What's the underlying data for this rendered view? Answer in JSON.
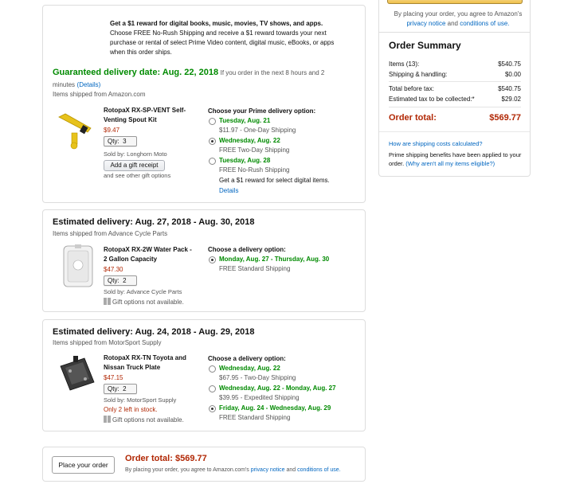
{
  "right_top": {
    "agree_prefix": "By placing your order, you agree to Amazon's",
    "privacy_link": "privacy notice",
    "and_text": "and",
    "conditions_link": "conditions of use."
  },
  "summary": {
    "title": "Order Summary",
    "items_label": "Items (13):",
    "items_value": "$540.75",
    "shipping_label": "Shipping & handling:",
    "shipping_value": "$0.00",
    "before_tax_label": "Total before tax:",
    "before_tax_value": "$540.75",
    "tax_label": "Estimated tax to be collected:*",
    "tax_value": "$29.02",
    "total_label": "Order total:",
    "total_value": "$569.77",
    "shipping_calc_link": "How are shipping costs calculated?",
    "prime_note": "Prime shipping benefits have been applied to your order.",
    "prime_link": "(Why aren't all my items eligible?)"
  },
  "shipment1": {
    "promo_line1": "Get a $1 reward for digital books, music, movies, TV shows, and apps.",
    "promo_line2": "Choose FREE No-Rush Shipping and receive a $1 reward towards your next",
    "promo_line3": "purchase or rental of select Prime Video content, digital music, eBooks, or apps",
    "promo_line4": "when this order ships.",
    "guaranteed": "Guaranteed delivery date: Aug. 22, 2018",
    "if_order": "If you order in the next 8 hours and 2",
    "minutes": "minutes",
    "details_link": "(Details)",
    "shipped_from": "Items shipped from Amazon.com",
    "product_name_1": "RotopaX RX-SP-VENT Self-",
    "product_name_2": "Venting Spout Kit",
    "price": "$9.47",
    "qty_label": "Qty:",
    "qty_value": "3",
    "sold_by": "Sold by: Longhorn Moto",
    "gift_receipt": "Add a gift receipt",
    "other_gift": "and see other gift options",
    "choose_label": "Choose your Prime delivery option:",
    "options": [
      {
        "date": "Tuesday, Aug. 21",
        "desc": "$11.97 - One-Day Shipping",
        "selected": false
      },
      {
        "date": "Wednesday, Aug. 22",
        "desc": "FREE Two-Day Shipping",
        "selected": true
      },
      {
        "date": "Tuesday, Aug. 28",
        "desc": "FREE No-Rush Shipping",
        "selected": false
      }
    ],
    "reward_note": "Get a $1 reward for select digital items.",
    "reward_details": "Details"
  },
  "shipment2": {
    "heading": "Estimated delivery: Aug. 27, 2018 - Aug. 30, 2018",
    "shipped_from": "Items shipped from Advance Cycle Parts",
    "product_name_1": "RotopaX RX-2W Water Pack -",
    "product_name_2": "2 Gallon Capacity",
    "price": "$47.30",
    "qty_label": "Qty:",
    "qty_value": "2",
    "sold_by": "Sold by: Advance Cycle Parts",
    "gift_note": "Gift options not available.",
    "choose_label": "Choose a delivery option:",
    "options": [
      {
        "date": "Monday, Aug. 27 - Thursday, Aug. 30",
        "desc": "FREE Standard Shipping",
        "selected": true
      }
    ]
  },
  "shipment3": {
    "heading": "Estimated delivery: Aug. 24, 2018 - Aug. 29, 2018",
    "shipped_from": "Items shipped from MotorSport Supply",
    "product_name_1": "RotopaX RX-TN Toyota and",
    "product_name_2": "Nissan Truck Plate",
    "price": "$47.15",
    "qty_label": "Qty:",
    "qty_value": "2",
    "sold_by": "Sold by: MotorSport Supply",
    "stock": "Only 2 left in stock.",
    "gift_note": "Gift options not available.",
    "choose_label": "Choose a delivery option:",
    "options": [
      {
        "date": "Wednesday, Aug. 22",
        "desc": "$67.95 - Two-Day Shipping",
        "selected": false
      },
      {
        "date": "Wednesday, Aug. 22 - Monday, Aug. 27",
        "desc": "$39.95 - Expedited Shipping",
        "selected": false
      },
      {
        "date": "Friday, Aug. 24 - Wednesday, Aug. 29",
        "desc": "FREE Standard Shipping",
        "selected": true
      }
    ]
  },
  "bottom": {
    "place_order": "Place your order",
    "total_label": "Order total:",
    "total_value": "$569.77",
    "agree_prefix": "By placing your order, you agree to Amazon.com's",
    "privacy_link": "privacy notice",
    "and_text": "and",
    "conditions_link": "conditions of use."
  }
}
